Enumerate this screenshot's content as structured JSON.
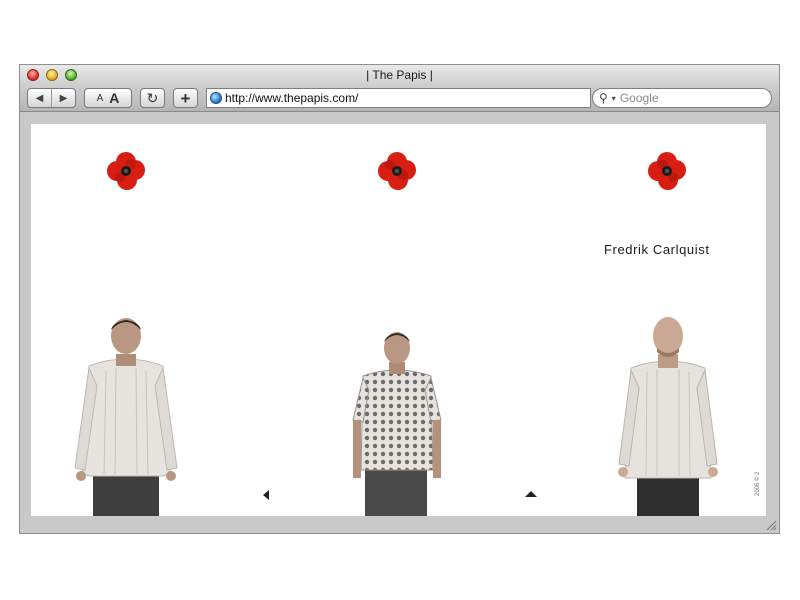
{
  "window": {
    "title": "| The Papis |"
  },
  "toolbar": {
    "back_icon": "◀",
    "forward_icon": "▶",
    "text_smaller": "A",
    "text_larger": "A",
    "reload_icon": "↻",
    "add_icon": "+",
    "address_value": "http://www.thepapis.com/",
    "address_caret": "⌃",
    "search_placeholder": "Google",
    "search_icon": "⚲",
    "search_arrow": "▾"
  },
  "page": {
    "name_label": "Fredrik Carlquist",
    "side_text": "2006 © 2",
    "poppy_color": "#d81e12"
  }
}
